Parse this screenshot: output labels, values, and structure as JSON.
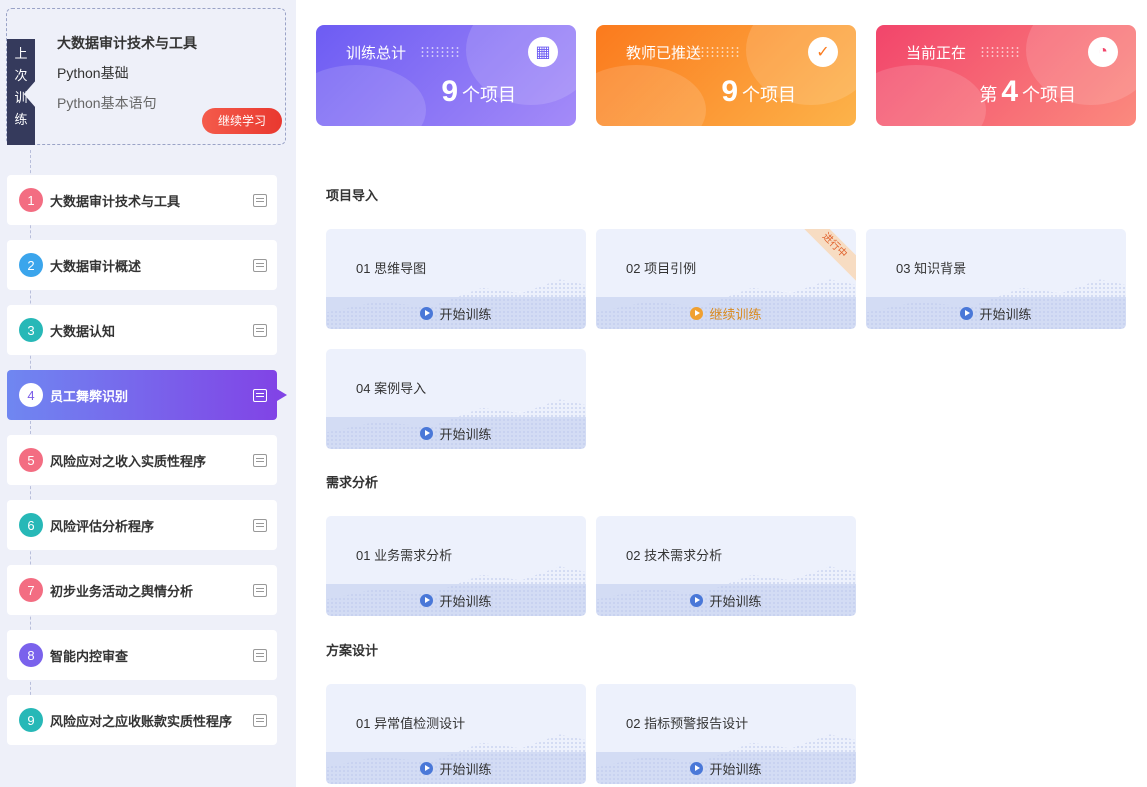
{
  "last_training": {
    "tag": [
      "上",
      "次",
      "训",
      "练"
    ],
    "course": "大数据审计技术与工具",
    "line1": "Python基础",
    "line2": "Python基本语句",
    "button": "继续学习"
  },
  "stats": [
    {
      "title": "训练总计",
      "prefix": "",
      "value": "9",
      "unit": "个项目",
      "icon": "grid-icon",
      "colors": [
        "#6d5cf3",
        "#a48bf8"
      ]
    },
    {
      "title": "教师已推送",
      "prefix": "",
      "value": "9",
      "unit": "个项目",
      "icon": "check-icon",
      "colors": [
        "#fb7a1d",
        "#fcb34a"
      ]
    },
    {
      "title": "当前正在",
      "prefix": "第",
      "value": "4",
      "unit": "个项目",
      "icon": "clock-icon",
      "colors": [
        "#f2456b",
        "#fb8a7e"
      ]
    }
  ],
  "chapters": [
    {
      "num": "1",
      "label": "大数据审计技术与工具",
      "color": "#f36d82"
    },
    {
      "num": "2",
      "label": "大数据审计概述",
      "color": "#3ba5ec"
    },
    {
      "num": "3",
      "label": "大数据认知",
      "color": "#27b8b7"
    },
    {
      "num": "4",
      "label": "员工舞弊识别",
      "color": "#ffffff",
      "active": true
    },
    {
      "num": "5",
      "label": "风险应对之收入实质性程序",
      "color": "#f36d82"
    },
    {
      "num": "6",
      "label": "风险评估分析程序",
      "color": "#27b8b7"
    },
    {
      "num": "7",
      "label": "初步业务活动之舆情分析",
      "color": "#f36d82"
    },
    {
      "num": "8",
      "label": "智能内控审查",
      "color": "#7a62ec"
    },
    {
      "num": "9",
      "label": "风险应对之应收账款实质性程序",
      "color": "#27b8b7"
    }
  ],
  "sections": [
    {
      "title": "项目导入",
      "cards": [
        {
          "name": "01 思维导图",
          "action": "开始训练"
        },
        {
          "name": "02 项目引例",
          "action": "继续训练",
          "badge": "进行中"
        },
        {
          "name": "03 知识背景",
          "action": "开始训练"
        },
        {
          "name": "04 案例导入",
          "action": "开始训练"
        }
      ]
    },
    {
      "title": "需求分析",
      "cards": [
        {
          "name": "01 业务需求分析",
          "action": "开始训练"
        },
        {
          "name": "02 技术需求分析",
          "action": "开始训练"
        }
      ]
    },
    {
      "title": "方案设计",
      "cards": [
        {
          "name": "01 异常值检测设计",
          "action": "开始训练"
        },
        {
          "name": "02 指标预警报告设计",
          "action": "开始训练"
        }
      ]
    }
  ]
}
